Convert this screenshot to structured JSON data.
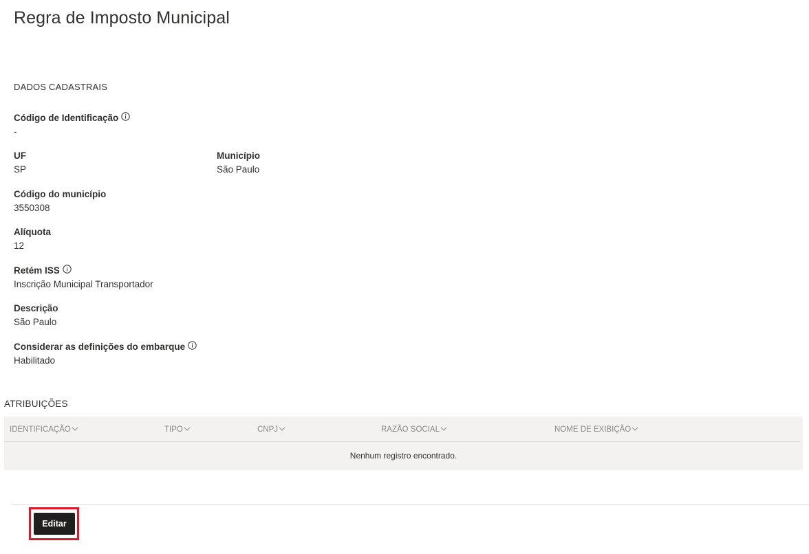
{
  "page": {
    "title": "Regra de Imposto Municipal"
  },
  "dados": {
    "section_title": "DADOS CADASTRAIS",
    "codigo_identificacao": {
      "label": "Código de Identificação",
      "value": "-"
    },
    "uf": {
      "label": "UF",
      "value": "SP"
    },
    "municipio": {
      "label": "Município",
      "value": "São Paulo"
    },
    "codigo_municipio": {
      "label": "Código do município",
      "value": "3550308"
    },
    "aliquota": {
      "label": "Alíquota",
      "value": "12"
    },
    "retem_iss": {
      "label": "Retém ISS",
      "value": "Inscrição Municipal Transportador"
    },
    "descricao": {
      "label": "Descrição",
      "value": "São Paulo"
    },
    "considerar": {
      "label": "Considerar as definições do embarque",
      "value": "Habilitado"
    }
  },
  "atribuicoes": {
    "section_title": "ATRIBUIÇÕES",
    "columns": [
      "IDENTIFICAÇÃO",
      "TIPO",
      "CNPJ",
      "RAZÃO SOCIAL",
      "NOME DE EXIBIÇÃO"
    ],
    "empty_message": "Nenhum registro encontrado."
  },
  "footer": {
    "edit_label": "Editar"
  },
  "colors": {
    "button_bg": "#201f1e",
    "highlight": "#e0162b",
    "grid_bg": "#f3f2f1",
    "header_text": "#8a8886"
  },
  "icons": {
    "info": "info-icon",
    "sort": "chevron-down-icon"
  }
}
